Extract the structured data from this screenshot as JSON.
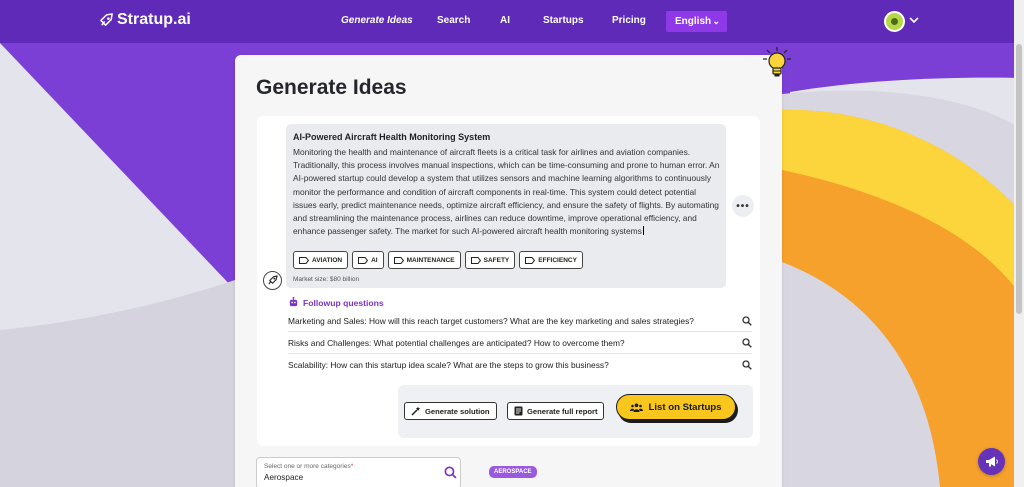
{
  "nav": {
    "logo": "Stratup.ai",
    "links": [
      "Generate Ideas",
      "Search",
      "AI",
      "Startups",
      "Pricing"
    ],
    "language": "English"
  },
  "page": {
    "title": "Generate Ideas"
  },
  "idea": {
    "title": "AI-Powered Aircraft Health Monitoring System",
    "body": "Monitoring the health and maintenance of aircraft fleets is a critical task for airlines and aviation companies. Traditionally, this process involves manual inspections, which can be time-consuming and prone to human error. An AI-powered startup could develop a system that utilizes sensors and machine learning algorithms to continuously monitor the performance and condition of aircraft components in real-time. This system could detect potential issues early, predict maintenance needs, optimize aircraft efficiency, and ensure the safety of flights. By automating and streamlining the maintenance process, airlines can reduce downtime, improve operational efficiency, and enhance passenger safety. The market for such AI-powered aircraft health monitoring systems",
    "tags": [
      "AVIATION",
      "AI",
      "MAINTENANCE",
      "SAFETY",
      "EFFICIENCY"
    ],
    "market_size": "Market size: $80 billion"
  },
  "followup": {
    "heading": "Followup questions",
    "questions": [
      "Marketing and Sales: How will this reach target customers? What are the key marketing and sales strategies?",
      "Risks and Challenges: What potential challenges are anticipated? How to overcome them?",
      "Scalability: How can this startup idea scale? What are the steps to grow this business?"
    ]
  },
  "actions": {
    "generate_solution": "Generate solution",
    "generate_report": "Generate full report",
    "list_on_startups": "List on Startups"
  },
  "category": {
    "label": "Select one or more categories",
    "required_mark": "*",
    "value": "Aerospace",
    "chip": "AEROSPACE"
  },
  "colors": {
    "nav_bg": "#5f2ab8",
    "accent_purple": "#8f38e8",
    "primary_yellow": "#f8c61c",
    "followup_purple": "#7d32c7"
  },
  "icons": [
    "stratup-logo-icon",
    "chevron-down-icon",
    "lightbulb-icon",
    "more-icon",
    "rocket-icon",
    "tag-icon",
    "robot-icon",
    "search-icon",
    "magic-wand-icon",
    "document-icon",
    "group-icon",
    "megaphone-icon"
  ]
}
